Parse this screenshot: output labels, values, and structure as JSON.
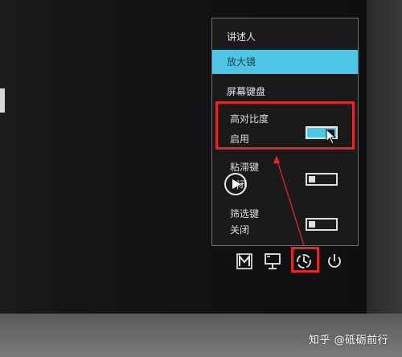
{
  "menu": {
    "narrator": "讲述人",
    "magnifier": "放大镜",
    "on_screen_keyboard": "屏幕键盘"
  },
  "high_contrast": {
    "title": "高对比度",
    "state": "启用",
    "toggle_on": true
  },
  "sticky_keys": {
    "title": "粘滞键",
    "state_partial": "闭",
    "toggle_on": false
  },
  "filter_keys": {
    "title": "筛选键",
    "state": "关闭",
    "toggle_on": false
  },
  "bottom_icons": [
    "narrator-m-icon",
    "display-icon",
    "ease-of-access-icon",
    "power-icon"
  ],
  "watermark": "知乎 @砥砺前行",
  "colors": {
    "accent": "#4fc6e6",
    "highlight": "#e3262b",
    "panel": "#1a1a1a"
  }
}
